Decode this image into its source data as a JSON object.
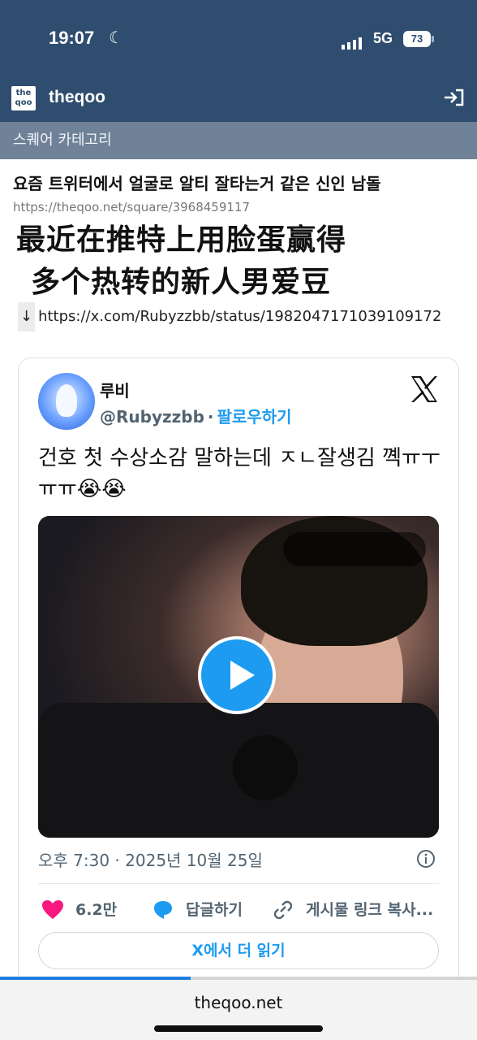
{
  "status_bar": {
    "time": "19:07",
    "network": "5G",
    "battery": "73"
  },
  "header": {
    "brand": "theqoo",
    "logo_text": "the qoo"
  },
  "category": {
    "label": "스퀘어 카테고리"
  },
  "post": {
    "title": "요즘 트위터에서 얼굴로 알티 잘타는거 같은 신인 남돌",
    "url": "https://theqoo.net/square/3968459117",
    "overlay_line1": "最近在推特上用脸蛋赢得",
    "overlay_line2": "多个热转的新人男爱豆",
    "link_arrow": "↓",
    "link": "https://x.com/Rubyzzbb/status/1982047171039109172"
  },
  "tweet": {
    "display_name": "루비",
    "handle": "@Rubyzzbb",
    "dot": "·",
    "follow_label": "팔로우하기",
    "text": "건호 첫 수상소감 말하는데 ㅈㄴ잘생김 꼑ㅠㅜㅠㅠ😭😭",
    "date": "오후 7:30 · 2025년 10월 25일",
    "likes": "6.2만",
    "reply_label": "답글하기",
    "share_label": "게시물 링크 복사...",
    "read_more_prefix": "X",
    "read_more_label": "에서 더 읽기"
  },
  "footer": {
    "domain": "theqoo.net",
    "load_progress": 0.4
  },
  "colors": {
    "header": "#2f4d6e",
    "category": "#6f8298",
    "accent": "#1d9bf0",
    "like": "#f91880"
  },
  "icons": [
    "moon-icon",
    "signal-icon",
    "battery-icon",
    "login-icon",
    "x-logo-icon",
    "play-icon",
    "info-icon",
    "heart-icon",
    "reply-icon",
    "link-icon"
  ]
}
